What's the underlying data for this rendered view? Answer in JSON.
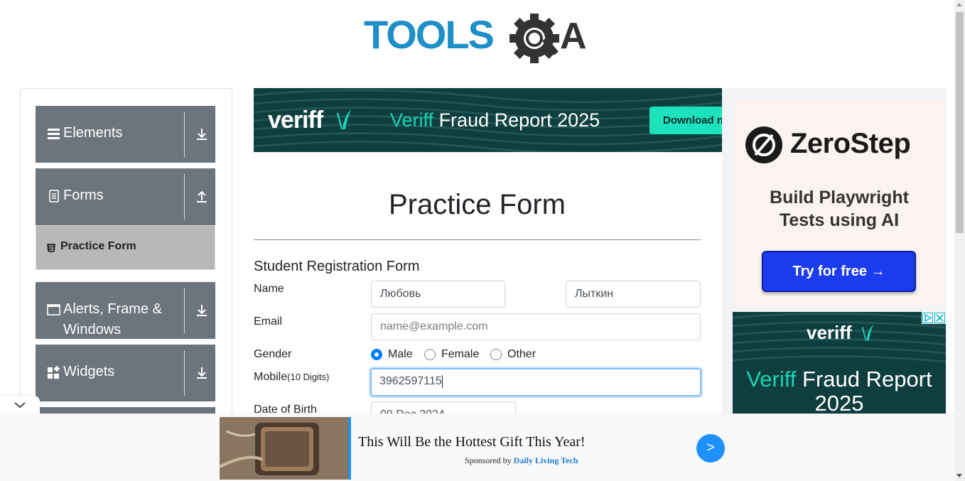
{
  "header": {
    "logo_text_left": "TOOLS",
    "logo_text_right": "A"
  },
  "sidebar": {
    "groups": [
      {
        "label": "Elements",
        "icon": "hamburger-icon",
        "arrow": "download-arrow-icon"
      },
      {
        "label": "Forms",
        "icon": "document-icon",
        "arrow": "upload-arrow-icon"
      },
      {
        "label": "Alerts, Frame & Windows",
        "icon": "window-icon",
        "arrow": "download-arrow-icon"
      },
      {
        "label": "Widgets",
        "icon": "widgets-icon",
        "arrow": "download-arrow-icon"
      }
    ],
    "active_item": {
      "label": "Practice Form",
      "icon": "html5-icon"
    }
  },
  "top_ad": {
    "brand": "veriff",
    "title_accent": "Veriff",
    "title_rest": "Fraud Report 2025",
    "button": "Download n"
  },
  "form": {
    "title": "Practice Form",
    "subtitle": "Student Registration Form",
    "name_label": "Name",
    "first_name": "Любовь",
    "last_name": "Лыткин",
    "email_label": "Email",
    "email_placeholder": "name@example.com",
    "gender_label": "Gender",
    "genders": [
      "Male",
      "Female",
      "Other"
    ],
    "selected_gender": "Male",
    "mobile_label": "Mobile",
    "mobile_hint": "(10 Digits)",
    "mobile_value": "3962597115",
    "dob_label": "Date of Birth",
    "dob_value": "09 Dec 2024"
  },
  "right_ad": {
    "brand": "ZeroStep",
    "tagline": "Build Playwright Tests using AI",
    "button": "Try for free →"
  },
  "right_ad2": {
    "brand": "veriff",
    "title_accent": "Veriff",
    "title_rest": "Fraud Report 2025"
  },
  "bottom_ad": {
    "headline": "This Will Be the Hottest Gift This Year!",
    "sponsored_by": "Sponsored by",
    "sponsor": "Daily Living Tech",
    "go": ">"
  },
  "colors": {
    "brand_blue": "#1e8fc9",
    "sidebar_group": "#6c757d",
    "active_item": "#b8b8b8",
    "focus": "#80bdff",
    "radio_on": "#007bff"
  }
}
